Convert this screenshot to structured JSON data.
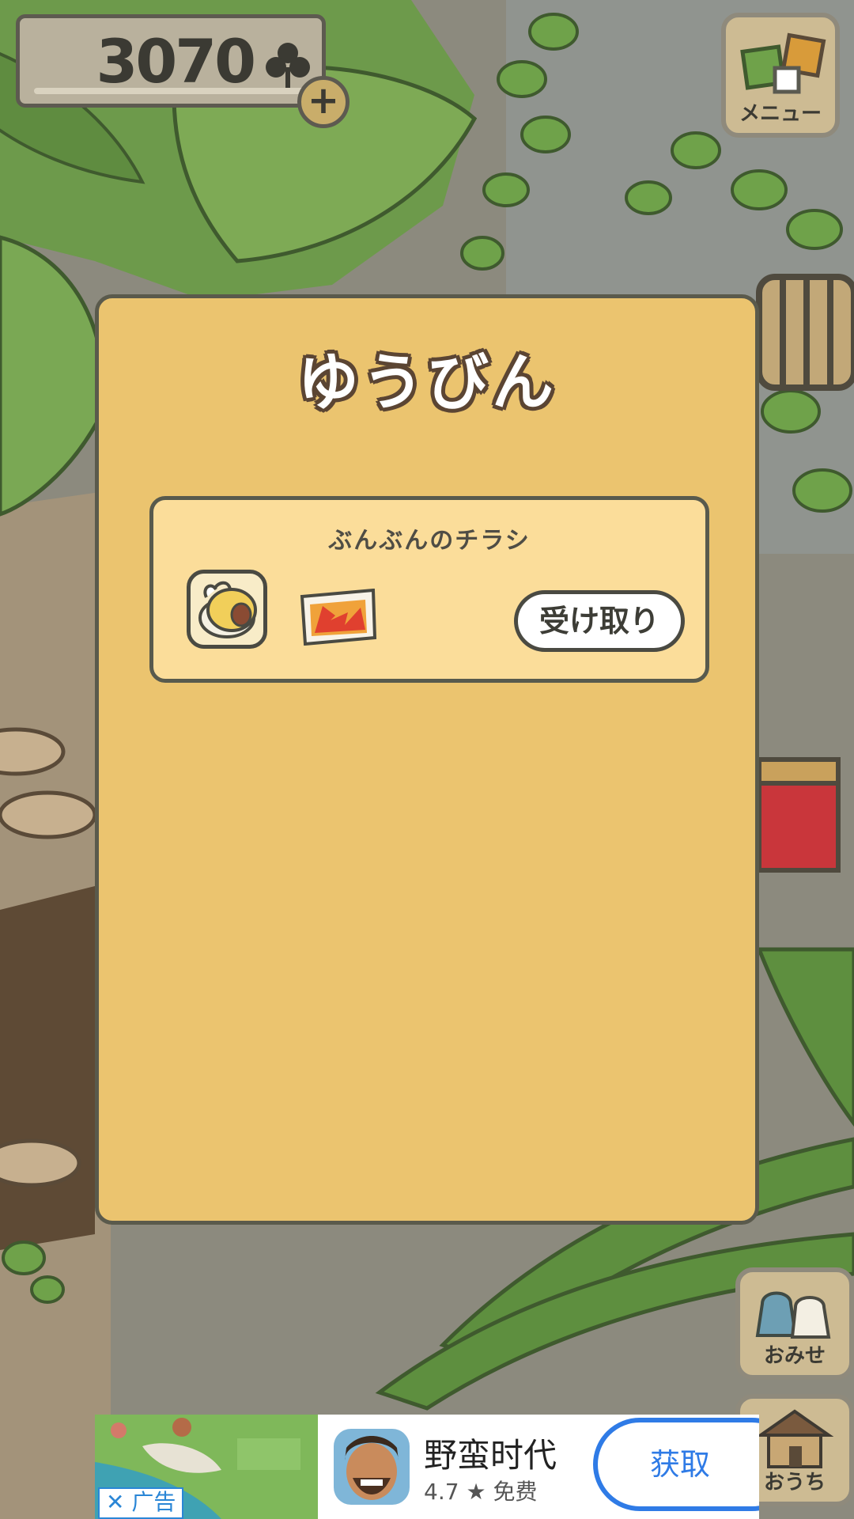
{
  "hud": {
    "clover_count": "3070",
    "add_button_label": "+",
    "menu_label": "メニュー"
  },
  "mail_panel": {
    "title": "ゆうびん",
    "items": [
      {
        "sender": "ぶんぶんのチラシ",
        "receive_label": "受け取り"
      }
    ]
  },
  "side_buttons": {
    "shop_label": "おみせ",
    "home_label": "おうち"
  },
  "ad": {
    "close_label": "✕ 广告",
    "app_name": "野蛮时代",
    "rating": "4.7",
    "price": "免费",
    "get_label": "获取"
  },
  "colors": {
    "panel_bg": "#ebc46f",
    "item_bg": "#fbdd9a",
    "ad_accent": "#2f7be6"
  }
}
